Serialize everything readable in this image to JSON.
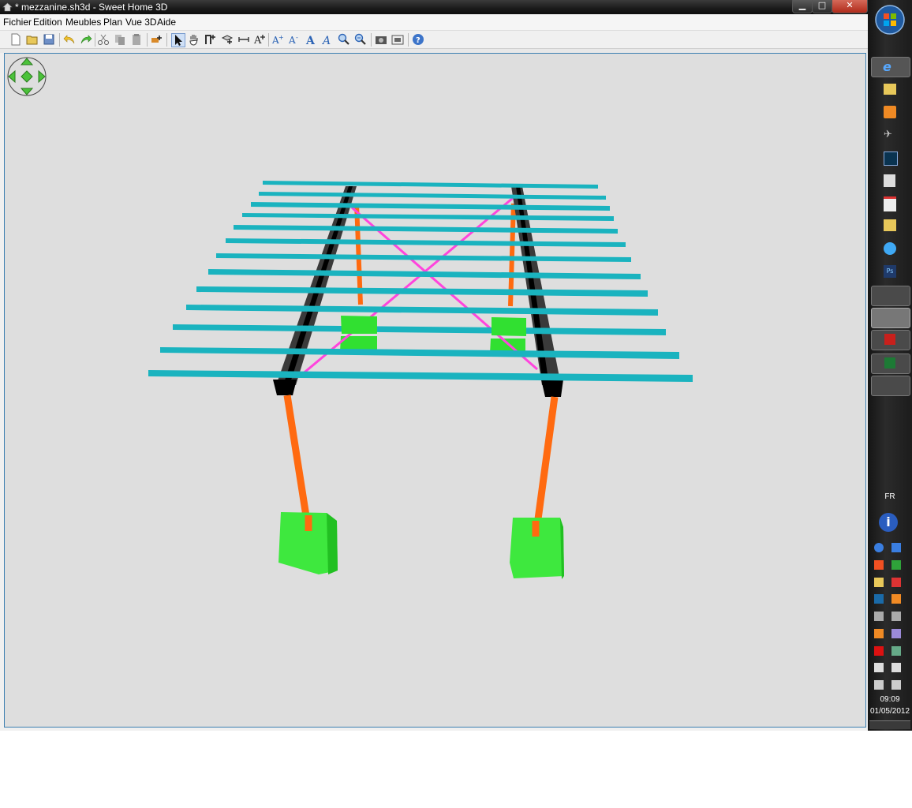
{
  "window": {
    "title": "* mezzanine.sh3d - Sweet Home 3D"
  },
  "title_buttons": {
    "minimize": "▁",
    "maximize": "□",
    "close": "✕"
  },
  "menu": [
    "Fichier",
    "Edition",
    "Meubles",
    "Plan",
    "Vue 3D",
    "Aide"
  ],
  "toolbar": [
    "new-icon",
    "open-icon",
    "save-icon",
    "undo-icon",
    "redo-icon",
    "cut-icon",
    "copy-icon",
    "paste-icon",
    "add-furniture-icon",
    "select-icon",
    "pan-icon",
    "create-walls-icon",
    "create-rooms-icon",
    "create-dimensions-icon",
    "create-labels-icon",
    "increase-text-icon",
    "decrease-text-icon",
    "bold-icon",
    "italic-icon",
    "zoom-in-icon",
    "zoom-out-icon",
    "create-photo-icon",
    "create-video-icon",
    "help-icon"
  ],
  "taskbar": {
    "language": "FR",
    "time": "09:09",
    "date": "01/05/2012"
  },
  "colors": {
    "deck_joist": "#1ab3bf",
    "beam": "#3a3a3a",
    "post": "#ff6a10",
    "footing": "#3ee83e",
    "brace": "#ff44dd",
    "background": "#dedede",
    "view_border": "#3c7fb1"
  }
}
